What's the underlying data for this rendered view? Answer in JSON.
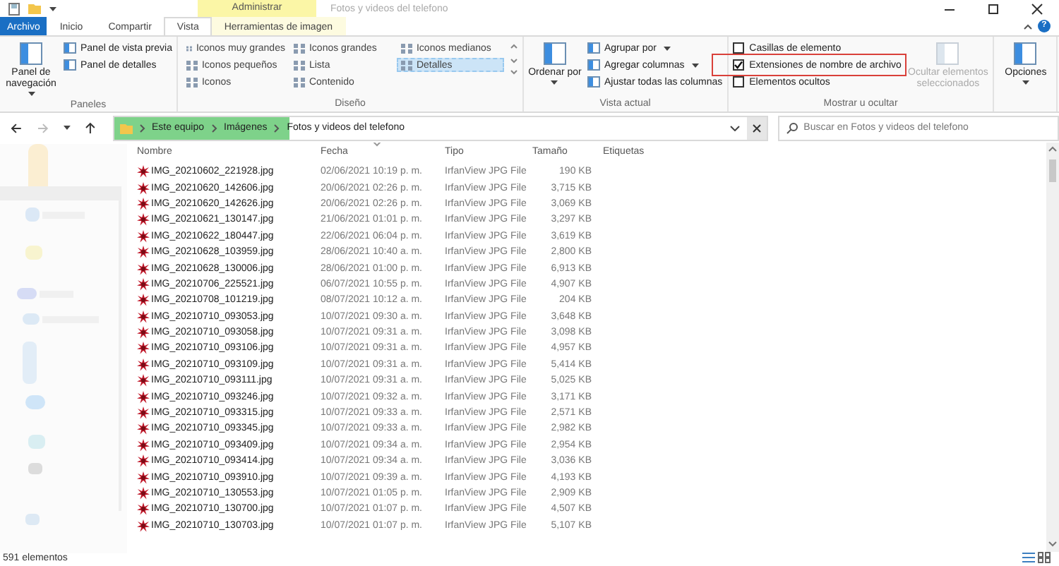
{
  "title_bar": {
    "context_tab": "Administrar",
    "title": "Fotos y videos del telefono"
  },
  "ribbon_tabs": [
    {
      "label": "Archivo",
      "kind": "file",
      "selected": false
    },
    {
      "label": "Inicio",
      "kind": "plain",
      "selected": false
    },
    {
      "label": "Compartir",
      "kind": "plain",
      "selected": false
    },
    {
      "label": "Vista",
      "kind": "plain",
      "selected": true
    },
    {
      "label": "Herramientas de imagen",
      "kind": "context",
      "selected": false
    }
  ],
  "help_button": "?",
  "ribbon_groups": [
    {
      "label": "Paneles",
      "items": [
        {
          "kind": "big",
          "label": "Panel de navegación",
          "dropdown": true
        },
        {
          "kind": "small",
          "label": "Panel de vista previa"
        },
        {
          "kind": "small",
          "label": "Panel de detalles"
        }
      ]
    },
    {
      "label": "Diseño",
      "items": [
        {
          "kind": "layout",
          "label": "Iconos muy grandes",
          "selected": false
        },
        {
          "kind": "layout",
          "label": "Iconos grandes",
          "selected": false
        },
        {
          "kind": "layout",
          "label": "Iconos medianos",
          "selected": false
        },
        {
          "kind": "layout",
          "label": "Iconos pequeños",
          "selected": false
        },
        {
          "kind": "layout",
          "label": "Lista",
          "selected": false
        },
        {
          "kind": "layout",
          "label": "Detalles",
          "selected": true
        },
        {
          "kind": "layout",
          "label": "Iconos",
          "selected": false
        },
        {
          "kind": "layout",
          "label": "Contenido",
          "selected": false
        }
      ]
    },
    {
      "label": "Vista actual",
      "items": [
        {
          "kind": "big",
          "label": "Ordenar por",
          "dropdown": true
        },
        {
          "kind": "small",
          "label": "Agrupar por",
          "dropdown": true
        },
        {
          "kind": "small",
          "label": "Agregar columnas",
          "dropdown": true
        },
        {
          "kind": "small",
          "label": "Ajustar todas las columnas"
        }
      ]
    },
    {
      "label": "Mostrar u ocultar",
      "items": [
        {
          "kind": "check",
          "label": "Casillas de elemento",
          "checked": false,
          "highlighted": false
        },
        {
          "kind": "check",
          "label": "Extensiones de nombre de archivo",
          "checked": true,
          "highlighted": true
        },
        {
          "kind": "check",
          "label": "Elementos ocultos",
          "checked": false,
          "highlighted": false
        },
        {
          "kind": "big",
          "label": "Ocultar elementos seleccionados",
          "disabled": true
        }
      ]
    },
    {
      "items": [
        {
          "kind": "big",
          "label": "Opciones",
          "dropdown": true
        }
      ]
    }
  ],
  "address_bar": {
    "level": 0.27,
    "crumbs": [
      "Este equipo",
      "Imágenes",
      "Fotos y videos del telefono"
    ]
  },
  "search": {
    "placeholder": "Buscar en Fotos y videos del telefono"
  },
  "columns": [
    {
      "label": "Nombre",
      "sorted": false
    },
    {
      "label": "Fecha",
      "sorted": true
    },
    {
      "label": "Tipo",
      "sorted": false
    },
    {
      "label": "Tamaño",
      "sorted": false
    },
    {
      "label": "Etiquetas",
      "sorted": false
    }
  ],
  "files": [
    {
      "name": "IMG_20210602_221928.jpg",
      "date": "02/06/2021 10:19 p. m.",
      "type": "IrfanView JPG File",
      "size": "190 KB"
    },
    {
      "name": "IMG_20210620_142606.jpg",
      "date": "20/06/2021 02:26 p. m.",
      "type": "IrfanView JPG File",
      "size": "3,715 KB"
    },
    {
      "name": "IMG_20210620_142626.jpg",
      "date": "20/06/2021 02:26 p. m.",
      "type": "IrfanView JPG File",
      "size": "3,069 KB"
    },
    {
      "name": "IMG_20210621_130147.jpg",
      "date": "21/06/2021 01:01 p. m.",
      "type": "IrfanView JPG File",
      "size": "3,297 KB"
    },
    {
      "name": "IMG_20210622_180447.jpg",
      "date": "22/06/2021 06:04 p. m.",
      "type": "IrfanView JPG File",
      "size": "3,619 KB"
    },
    {
      "name": "IMG_20210628_103959.jpg",
      "date": "28/06/2021 10:40 a. m.",
      "type": "IrfanView JPG File",
      "size": "2,800 KB"
    },
    {
      "name": "IMG_20210628_130006.jpg",
      "date": "28/06/2021 01:00 p. m.",
      "type": "IrfanView JPG File",
      "size": "6,913 KB"
    },
    {
      "name": "IMG_20210706_225521.jpg",
      "date": "06/07/2021 10:55 p. m.",
      "type": "IrfanView JPG File",
      "size": "4,907 KB"
    },
    {
      "name": "IMG_20210708_101219.jpg",
      "date": "08/07/2021 10:12 a. m.",
      "type": "IrfanView JPG File",
      "size": "204 KB"
    },
    {
      "name": "IMG_20210710_093053.jpg",
      "date": "10/07/2021 09:30 a. m.",
      "type": "IrfanView JPG File",
      "size": "3,648 KB"
    },
    {
      "name": "IMG_20210710_093058.jpg",
      "date": "10/07/2021 09:31 a. m.",
      "type": "IrfanView JPG File",
      "size": "3,098 KB"
    },
    {
      "name": "IMG_20210710_093106.jpg",
      "date": "10/07/2021 09:31 a. m.",
      "type": "IrfanView JPG File",
      "size": "4,957 KB"
    },
    {
      "name": "IMG_20210710_093109.jpg",
      "date": "10/07/2021 09:31 a. m.",
      "type": "IrfanView JPG File",
      "size": "5,414 KB"
    },
    {
      "name": "IMG_20210710_093111.jpg",
      "date": "10/07/2021 09:31 a. m.",
      "type": "IrfanView JPG File",
      "size": "5,025 KB"
    },
    {
      "name": "IMG_20210710_093246.jpg",
      "date": "10/07/2021 09:32 a. m.",
      "type": "IrfanView JPG File",
      "size": "3,171 KB"
    },
    {
      "name": "IMG_20210710_093315.jpg",
      "date": "10/07/2021 09:33 a. m.",
      "type": "IrfanView JPG File",
      "size": "2,571 KB"
    },
    {
      "name": "IMG_20210710_093345.jpg",
      "date": "10/07/2021 09:33 a. m.",
      "type": "IrfanView JPG File",
      "size": "2,982 KB"
    },
    {
      "name": "IMG_20210710_093409.jpg",
      "date": "10/07/2021 09:34 a. m.",
      "type": "IrfanView JPG File",
      "size": "2,954 KB"
    },
    {
      "name": "IMG_20210710_093414.jpg",
      "date": "10/07/2021 09:34 a. m.",
      "type": "IrfanView JPG File",
      "size": "3,036 KB"
    },
    {
      "name": "IMG_20210710_093910.jpg",
      "date": "10/07/2021 09:39 a. m.",
      "type": "IrfanView JPG File",
      "size": "4,193 KB"
    },
    {
      "name": "IMG_20210710_130553.jpg",
      "date": "10/07/2021 01:05 p. m.",
      "type": "IrfanView JPG File",
      "size": "2,909 KB"
    },
    {
      "name": "IMG_20210710_130700.jpg",
      "date": "10/07/2021 01:07 p. m.",
      "type": "IrfanView JPG File",
      "size": "4,507 KB"
    },
    {
      "name": "IMG_20210710_130703.jpg",
      "date": "10/07/2021 01:07 p. m.",
      "type": "IrfanView JPG File",
      "size": "5,107 KB"
    }
  ],
  "status_bar": {
    "count": "591 elementos"
  }
}
